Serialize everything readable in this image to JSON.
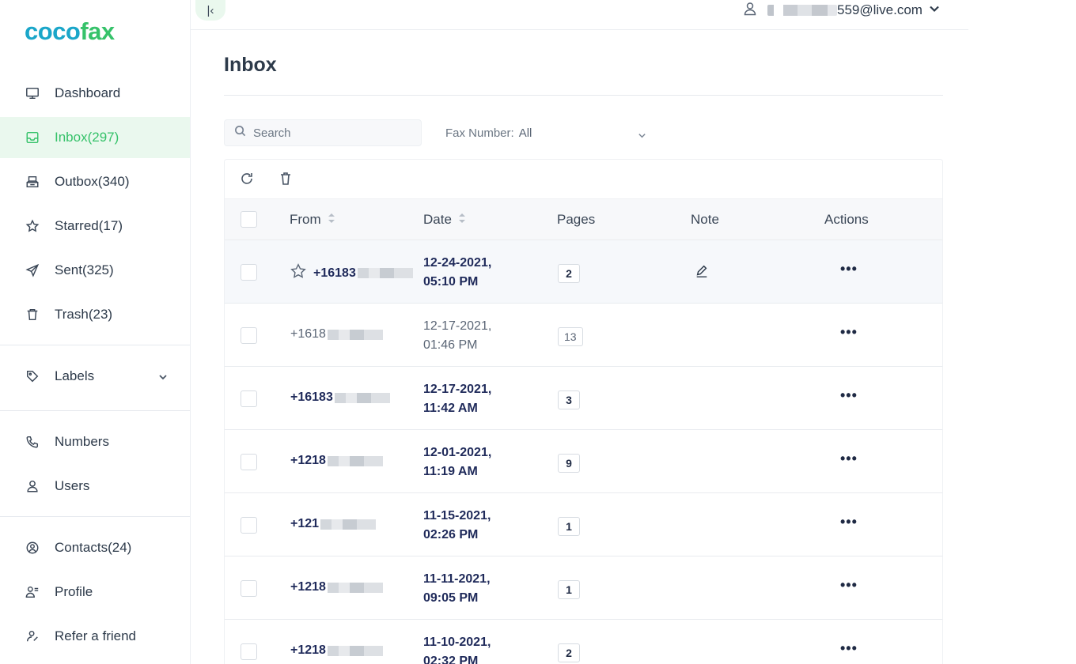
{
  "brand": {
    "part1": "coco",
    "part2": "fax"
  },
  "sidebar": {
    "items": [
      {
        "label": "Dashboard",
        "icon": "monitor-icon"
      },
      {
        "label": "Inbox(297)",
        "icon": "inbox-icon",
        "active": true
      },
      {
        "label": "Outbox(340)",
        "icon": "outbox-icon"
      },
      {
        "label": "Starred(17)",
        "icon": "star-icon"
      },
      {
        "label": "Sent(325)",
        "icon": "send-icon"
      },
      {
        "label": "Trash(23)",
        "icon": "trash-icon"
      }
    ],
    "labels": {
      "label": "Labels",
      "icon": "tag-icon"
    },
    "secondary": [
      {
        "label": "Numbers",
        "icon": "phone-icon"
      },
      {
        "label": "Users",
        "icon": "user-icon"
      }
    ],
    "tertiary": [
      {
        "label": "Contacts(24)",
        "icon": "contact-icon"
      },
      {
        "label": "Profile",
        "icon": "profile-icon"
      },
      {
        "label": "Refer a friend",
        "icon": "refer-icon"
      }
    ]
  },
  "topbar": {
    "email_suffix": "559@live.com"
  },
  "page": {
    "title": "Inbox"
  },
  "search": {
    "placeholder": "Search"
  },
  "filter": {
    "label": "Fax Number:",
    "value": "All"
  },
  "table": {
    "columns": {
      "from": "From",
      "date": "Date",
      "pages": "Pages",
      "note": "Note",
      "actions": "Actions"
    },
    "rows": [
      {
        "from": "+16183",
        "date1": "12-24-2021,",
        "date2": "05:10 PM",
        "pages": "2",
        "unread": true,
        "starred": true,
        "note": true
      },
      {
        "from": "+1618",
        "date1": "12-17-2021,",
        "date2": "01:46 PM",
        "pages": "13",
        "unread": false
      },
      {
        "from": "+16183",
        "date1": "12-17-2021,",
        "date2": "11:42 AM",
        "pages": "3",
        "unread": true
      },
      {
        "from": "+1218",
        "date1": "12-01-2021,",
        "date2": "11:19 AM",
        "pages": "9",
        "unread": true
      },
      {
        "from": "+121",
        "date1": "11-15-2021,",
        "date2": "02:26 PM",
        "pages": "1",
        "unread": true
      },
      {
        "from": "+1218",
        "date1": "11-11-2021,",
        "date2": "09:05 PM",
        "pages": "1",
        "unread": true
      },
      {
        "from": "+1218",
        "date1": "11-10-2021,",
        "date2": "02:32 PM",
        "pages": "2",
        "unread": true
      }
    ],
    "actions_label": "•••"
  }
}
